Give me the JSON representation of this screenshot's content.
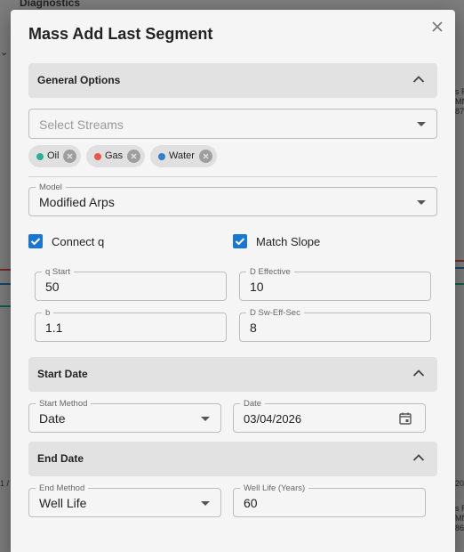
{
  "background": {
    "title": "Diagnostics",
    "right_text_1": "s R\nMN\n87",
    "right_text_2": "s R\nMN\n86",
    "left_text": "1 /",
    "right_text_3": "20"
  },
  "dialog": {
    "title": "Mass Add Last Segment",
    "close_icon": "close-icon"
  },
  "general_options": {
    "header": "General Options",
    "streams_placeholder": "Select Streams",
    "chips": [
      {
        "label": "Oil",
        "color": "#26b394"
      },
      {
        "label": "Gas",
        "color": "#e8554e"
      },
      {
        "label": "Water",
        "color": "#2f80d1"
      }
    ],
    "model_label": "Model",
    "model_value": "Modified Arps",
    "connect_q_label": "Connect q",
    "connect_q_checked": true,
    "match_slope_label": "Match Slope",
    "match_slope_checked": true,
    "q_start_label": "q Start",
    "q_start_value": "50",
    "d_effective_label": "D Effective",
    "d_effective_value": "10",
    "b_label": "b",
    "b_value": "1.1",
    "d_sw_label": "D Sw-Eff-Sec",
    "d_sw_value": "8"
  },
  "start_date": {
    "header": "Start Date",
    "method_label": "Start Method",
    "method_value": "Date",
    "date_label": "Date",
    "date_value": "03/04/2026"
  },
  "end_date": {
    "header": "End Date",
    "method_label": "End Method",
    "method_value": "Well Life",
    "life_label": "Well Life (Years)",
    "life_value": "60"
  },
  "colors": {
    "accent": "#1976d2",
    "section_bg": "#e2e2e2"
  }
}
